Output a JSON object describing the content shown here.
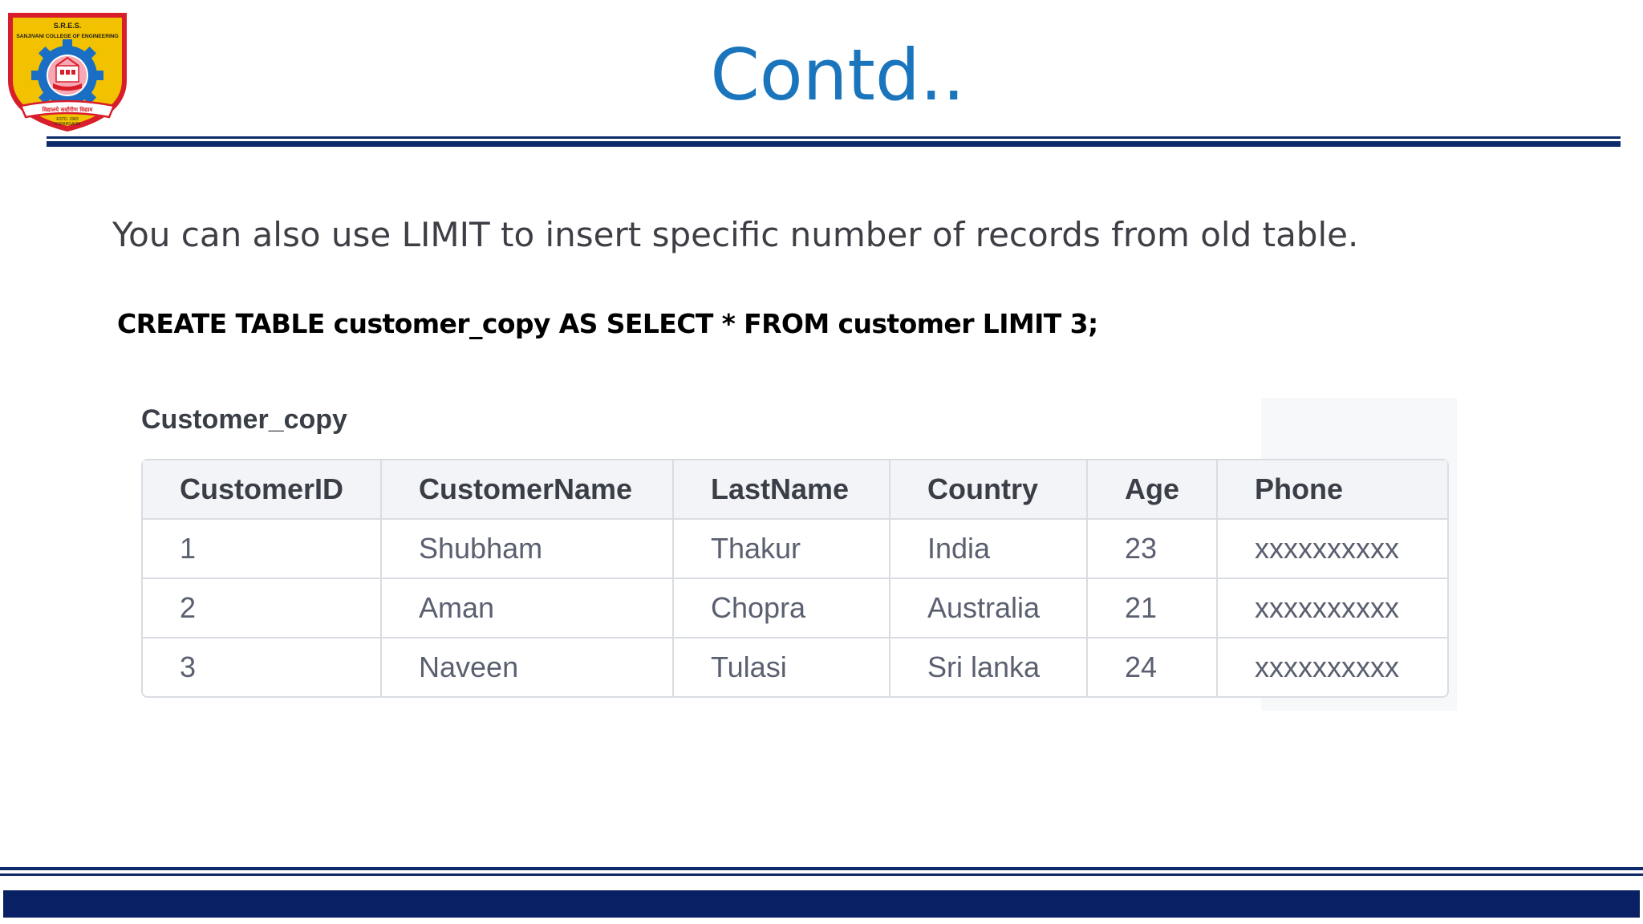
{
  "slide": {
    "title": "Contd..",
    "body_text": "You can also use LIMIT to insert specific number of records from old table.",
    "sql_statement": "CREATE TABLE customer_copy AS SELECT * FROM customer LIMIT 3;"
  },
  "logo": {
    "top_text": "S.R.E.S.",
    "college_name": "SANJIVANI COLLEGE OF ENGINEERING",
    "banner_text": "विद्यालये सर्वांगीण विद्याम",
    "estd": "ESTD. 1983",
    "place": "KOPARGAON",
    "colors": {
      "shield": "#f2c200",
      "border": "#d81e2a",
      "gear": "#1a6fc4"
    }
  },
  "table": {
    "caption": "Customer_copy",
    "columns": [
      "CustomerID",
      "CustomerName",
      "LastName",
      "Country",
      "Age",
      "Phone"
    ],
    "rows": [
      [
        "1",
        "Shubham",
        "Thakur",
        "India",
        "23",
        "xxxxxxxxxx"
      ],
      [
        "2",
        "Aman",
        "Chopra",
        "Australia",
        "21",
        "xxxxxxxxxx"
      ],
      [
        "3",
        "Naveen",
        "Tulasi",
        "Sri lanka",
        "24",
        "xxxxxxxxxx"
      ]
    ]
  },
  "colors": {
    "title": "#1a75bc",
    "rule": "#0d2a6b",
    "footer_bar": "#0a2064"
  }
}
